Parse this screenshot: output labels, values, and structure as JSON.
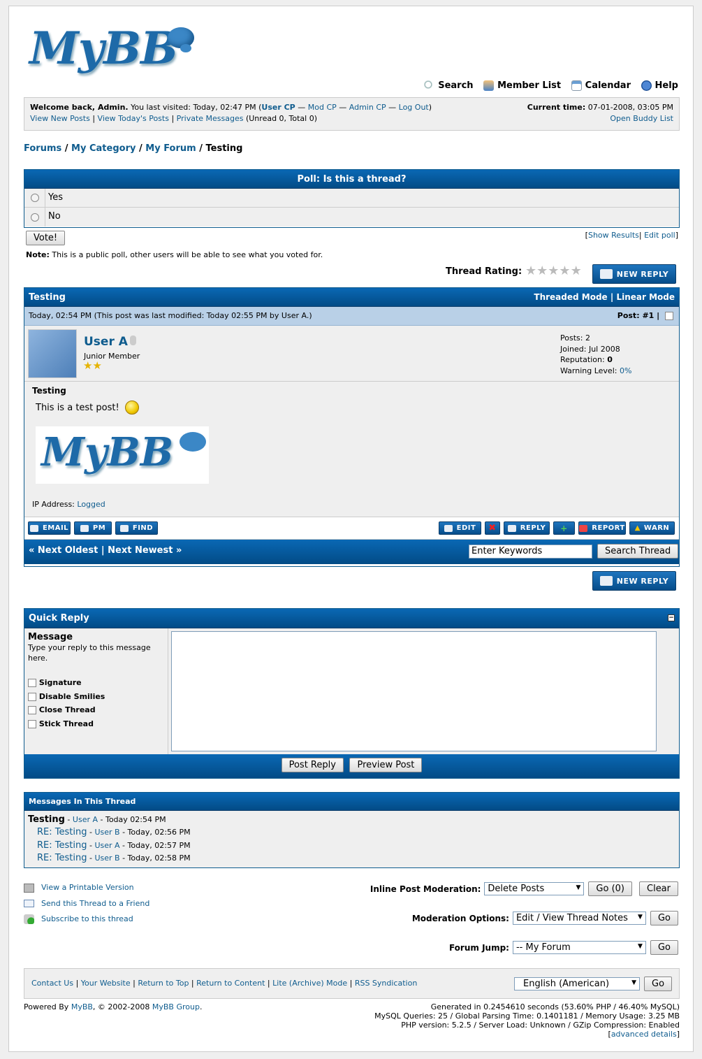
{
  "logo": "MyBB",
  "topmenu": {
    "search": "Search",
    "memberlist": "Member List",
    "calendar": "Calendar",
    "help": "Help"
  },
  "panel": {
    "welcome": "Welcome back, Admin.",
    "last_visited": "You last visited: Today, 02:47 PM (",
    "user_cp": "User CP",
    "mod_cp": "Mod CP",
    "admin_cp": "Admin CP",
    "logout": "Log Out",
    "close_paren": ")",
    "sep": "—",
    "view_new": "View New Posts",
    "view_today": "View Today's Posts",
    "pm": "Private Messages",
    "pm_counts": "(Unread 0, Total 0)",
    "time_label": "Current time:",
    "time_value": "07-01-2008, 03:05 PM",
    "buddy": "Open Buddy List"
  },
  "breadcrumb": {
    "forums": "Forums",
    "category": "My Category",
    "forum": "My Forum",
    "current": "Testing",
    "sep": "/"
  },
  "poll": {
    "title": "Poll: Is this a thread?",
    "options": [
      "Yes",
      "No"
    ],
    "vote": "Vote!",
    "show_results": "Show Results",
    "edit_poll": "Edit poll",
    "note_label": "Note:",
    "note": "This is a public poll, other users will be able to see what you voted for."
  },
  "rating_label": "Thread Rating:",
  "new_reply": "NEW REPLY",
  "thread": {
    "title": "Testing",
    "threaded": "Threaded Mode",
    "linear": "Linear Mode",
    "post_date": "Today, 02:54 PM (This post was last modified: Today 02:55 PM by User A.)",
    "post_num_label": "Post:",
    "post_num": "#1",
    "author": "User A",
    "usertitle": "Junior Member",
    "stats": {
      "posts_label": "Posts:",
      "posts": "2",
      "joined_label": "Joined:",
      "joined": "Jul 2008",
      "rep_label": "Reputation:",
      "rep": "0",
      "warn_label": "Warning Level:",
      "warn": "0%"
    },
    "subject": "Testing",
    "message": "This is a test post!",
    "ip_label": "IP Address:",
    "ip": "Logged",
    "buttons_left": [
      "EMAIL",
      "PM",
      "FIND"
    ],
    "buttons_right": [
      "EDIT",
      "REPLY",
      "REPORT",
      "WARN"
    ],
    "prev": "« Next Oldest",
    "next": "Next Newest »",
    "search_placeholder": "Enter Keywords",
    "search_btn": "Search Thread"
  },
  "quick_reply": {
    "title": "Quick Reply",
    "message_label": "Message",
    "message_desc": "Type your reply to this message here.",
    "options": [
      "Signature",
      "Disable Smilies",
      "Close Thread",
      "Stick Thread"
    ],
    "post_btn": "Post Reply",
    "preview_btn": "Preview Post"
  },
  "messages": {
    "title": "Messages In This Thread",
    "items": [
      {
        "subject": "Testing",
        "author": "User A",
        "date": "- Today 02:54 PM"
      },
      {
        "subject": "RE: Testing",
        "author": "User B",
        "date": "- Today, 02:56 PM"
      },
      {
        "subject": "RE: Testing",
        "author": "User A",
        "date": "- Today, 02:57 PM"
      },
      {
        "subject": "RE: Testing",
        "author": "User B",
        "date": "- Today, 02:58 PM"
      }
    ]
  },
  "links": {
    "printable": "View a Printable Version",
    "send": "Send this Thread to a Friend",
    "subscribe": "Subscribe to this thread"
  },
  "moderation": {
    "inline_label": "Inline Post Moderation:",
    "inline_value": "Delete Posts",
    "inline_go": "Go (0)",
    "clear": "Clear",
    "options_label": "Moderation Options:",
    "options_value": "Edit / View Thread Notes",
    "go": "Go",
    "jump_label": "Forum Jump:",
    "jump_value": "-- My Forum"
  },
  "footer": {
    "links": [
      "Contact Us",
      "Your Website",
      "Return to Top",
      "Return to Content",
      "Lite (Archive) Mode",
      "RSS Syndication"
    ],
    "language": "English (American)",
    "go": "Go",
    "powered_prefix": "Powered By",
    "mybb": "MyBB",
    "copyright": ", © 2002-2008",
    "group": "MyBB Group",
    "period": ".",
    "generated": "Generated in 0.2454610 seconds (53.60% PHP / 46.40% MySQL)",
    "queries": "MySQL Queries: 25 / Global Parsing Time: 0.1401181 / Memory Usage: 3.25 MB",
    "php": "PHP version: 5.2.5 / Server Load: Unknown / GZip Compression: Enabled",
    "advanced": "advanced details"
  }
}
